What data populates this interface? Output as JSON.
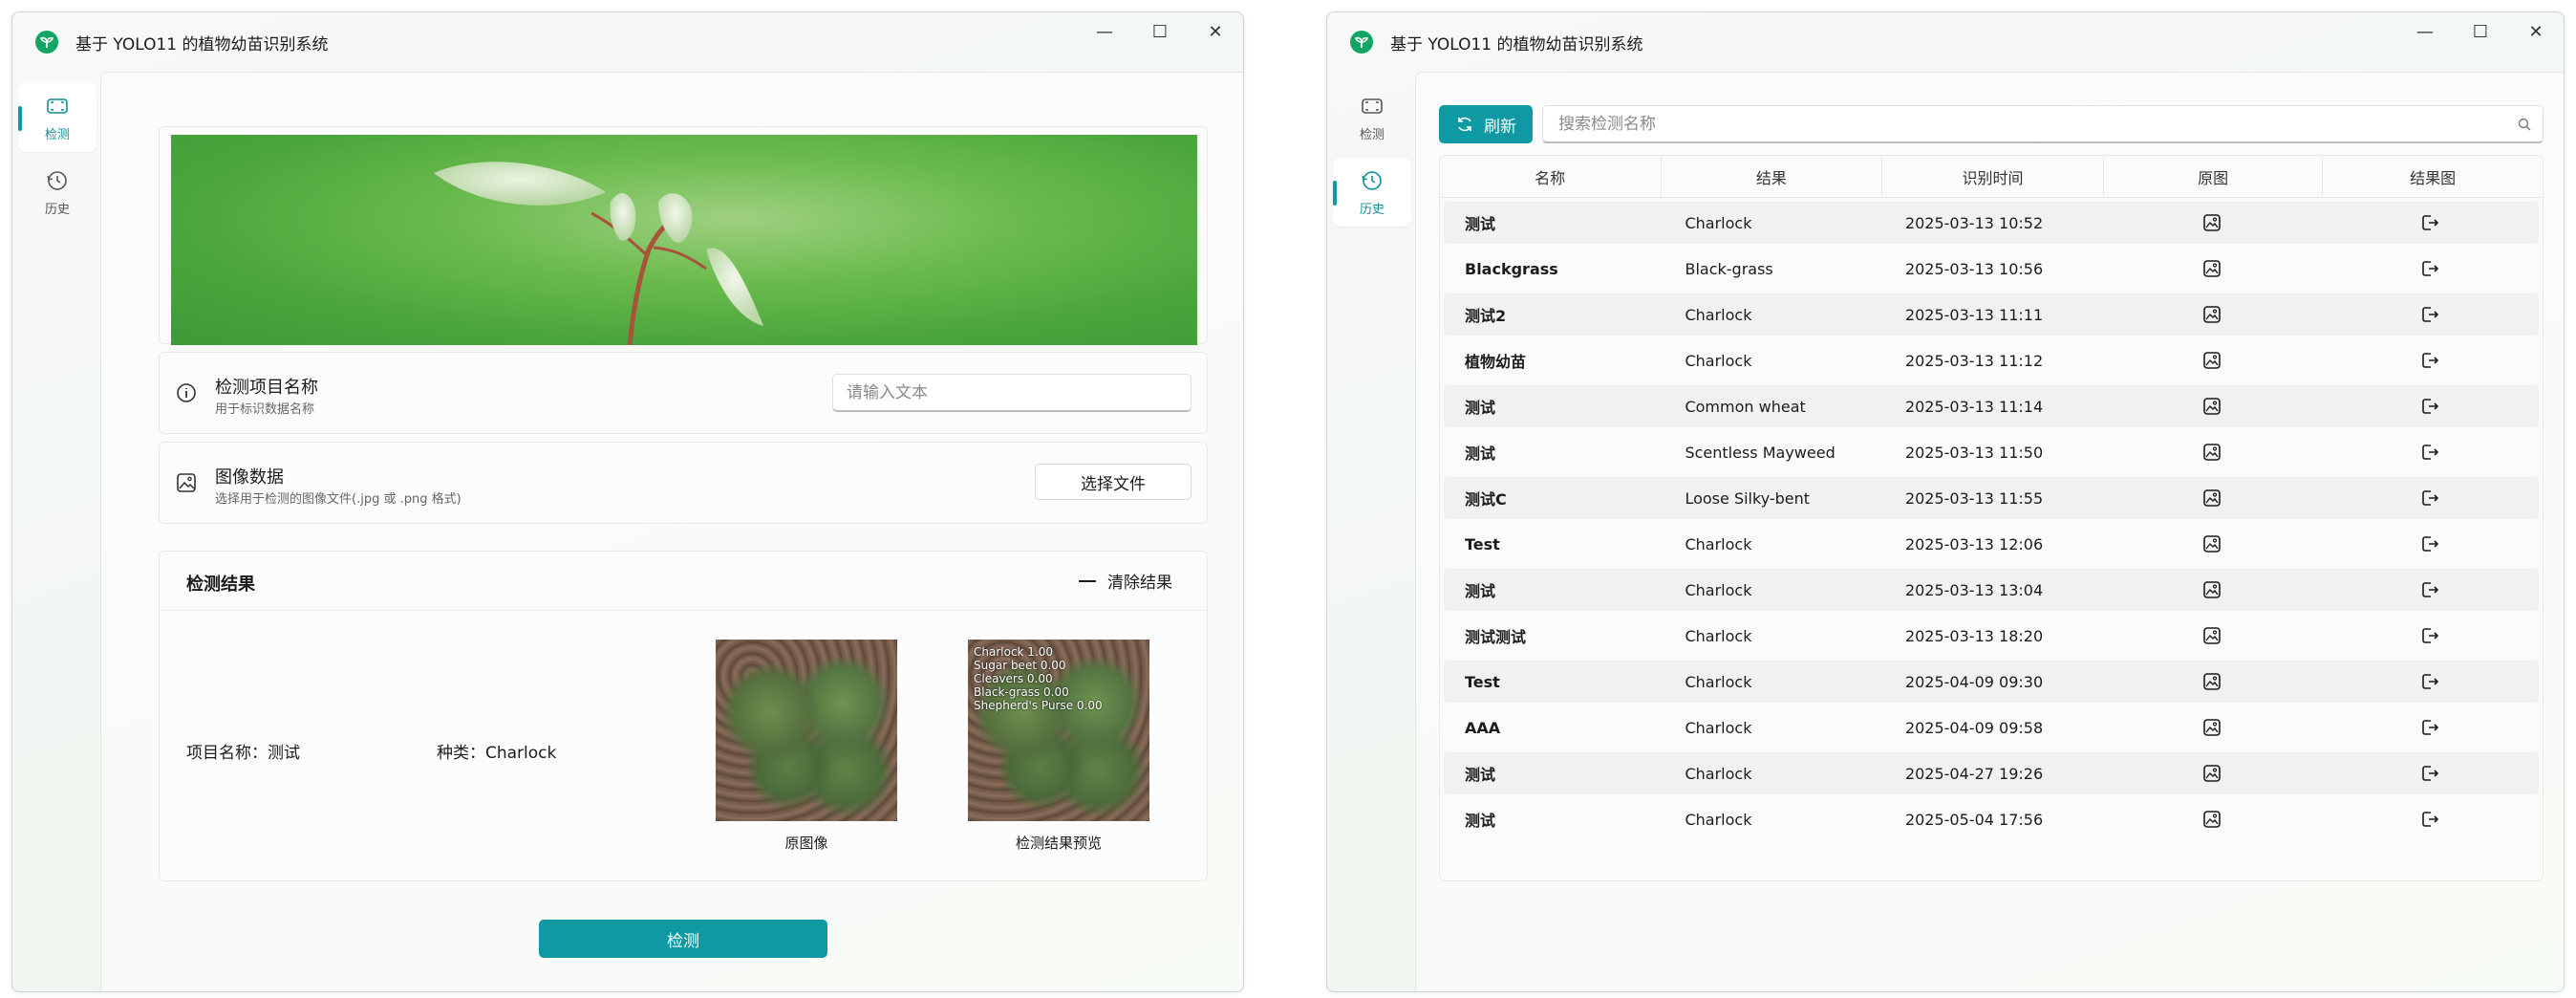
{
  "app": {
    "title": "基于 YOLO11 的植物幼苗识别系统",
    "window_controls": {
      "minimize": "—",
      "maximize": "☐",
      "close": "✕"
    },
    "nav": {
      "detect": "检测",
      "history": "历史"
    }
  },
  "colors": {
    "accent": "#0f9aa3",
    "app_icon": "#13a564"
  },
  "detect_page": {
    "project": {
      "title": "检测项目名称",
      "subtitle": "用于标识数据名称",
      "placeholder": "请输入文本"
    },
    "image": {
      "title": "图像数据",
      "subtitle": "选择用于检测的图像文件(.jpg 或 .png 格式)",
      "button": "选择文件"
    },
    "result": {
      "title": "检测结果",
      "clear_button": "清除结果",
      "project_name": "项目名称：测试",
      "species": "种类：Charlock",
      "original_caption": "原图像",
      "preview_caption": "检测结果预览",
      "preview_lines": [
        "Charlock 1.00",
        "Sugar beet 0.00",
        "Cleavers 0.00",
        "Black-grass 0.00",
        "Shepherd's Purse 0.00"
      ]
    },
    "detect_button": "检测"
  },
  "history_page": {
    "refresh_button": "刷新",
    "search_placeholder": "搜索检测名称",
    "columns": [
      "名称",
      "结果",
      "识别时间",
      "原图",
      "结果图"
    ],
    "rows": [
      {
        "name": "测试",
        "result": "Charlock",
        "time": "2025-03-13 10:52"
      },
      {
        "name": "Blackgrass",
        "result": "Black-grass",
        "time": "2025-03-13 10:56"
      },
      {
        "name": "测试2",
        "result": "Charlock",
        "time": "2025-03-13 11:11"
      },
      {
        "name": "植物幼苗",
        "result": "Charlock",
        "time": "2025-03-13 11:12"
      },
      {
        "name": "测试",
        "result": "Common wheat",
        "time": "2025-03-13 11:14"
      },
      {
        "name": "测试",
        "result": "Scentless Mayweed",
        "time": "2025-03-13 11:50"
      },
      {
        "name": "测试C",
        "result": "Loose Silky-bent",
        "time": "2025-03-13 11:55"
      },
      {
        "name": "Test",
        "result": "Charlock",
        "time": "2025-03-13 12:06"
      },
      {
        "name": "测试",
        "result": "Charlock",
        "time": "2025-03-13 13:04"
      },
      {
        "name": "测试测试",
        "result": "Charlock",
        "time": "2025-03-13 18:20"
      },
      {
        "name": "Test",
        "result": "Charlock",
        "time": "2025-04-09 09:30"
      },
      {
        "name": "AAA",
        "result": "Charlock",
        "time": "2025-04-09 09:58"
      },
      {
        "name": "测试",
        "result": "Charlock",
        "time": "2025-04-27 19:26"
      },
      {
        "name": "测试",
        "result": "Charlock",
        "time": "2025-05-04 17:56"
      }
    ]
  }
}
